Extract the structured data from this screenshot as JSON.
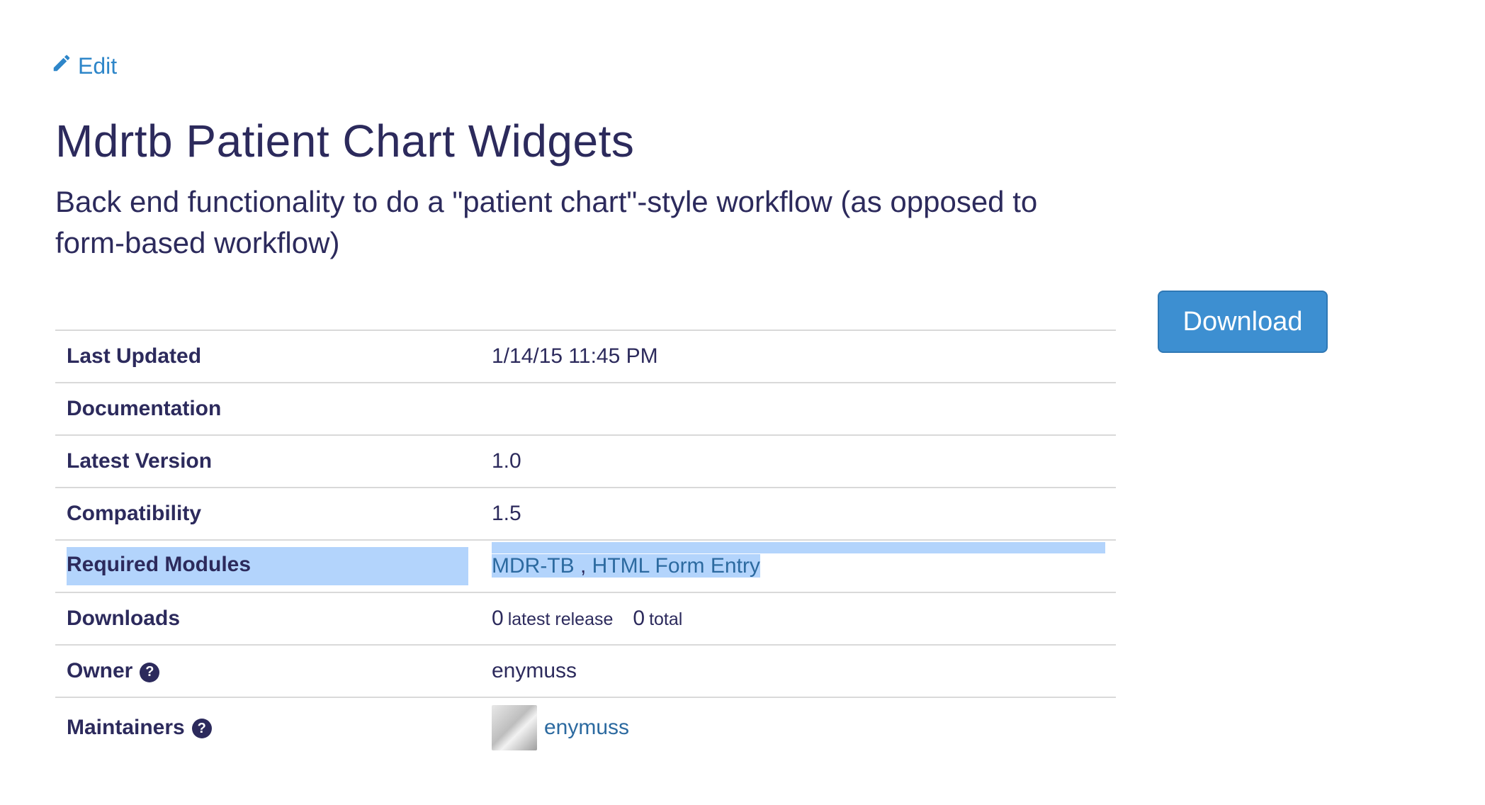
{
  "edit": {
    "label": "Edit"
  },
  "module": {
    "title": "Mdrtb Patient Chart Widgets",
    "description": "Back end functionality to do a \"patient chart\"-style workflow (as opposed to form-based workflow)"
  },
  "download": {
    "label": "Download"
  },
  "details": {
    "last_updated": {
      "label": "Last Updated",
      "value": "1/14/15 11:45 PM"
    },
    "documentation": {
      "label": "Documentation",
      "value": ""
    },
    "latest_version": {
      "label": "Latest Version",
      "value": "1.0"
    },
    "compatibility": {
      "label": "Compatibility",
      "value": "1.5"
    },
    "required_modules": {
      "label": "Required Modules",
      "modules": [
        "MDR-TB",
        "HTML Form Entry"
      ],
      "separator": " , "
    },
    "downloads": {
      "label": "Downloads",
      "latest_count": "0",
      "latest_label": "latest release",
      "total_count": "0",
      "total_label": "total"
    },
    "owner": {
      "label": "Owner",
      "value": "enymuss",
      "help": "?"
    },
    "maintainers": {
      "label": "Maintainers",
      "name": "enymuss",
      "help": "?"
    }
  },
  "colors": {
    "link": "#2e86c9",
    "text": "#2c2a5c",
    "button": "#3d8fd1",
    "selection": "#b3d4fc",
    "divider": "#d9d9d9"
  },
  "icons": {
    "edit": "pencil-icon",
    "help": "question-circle-icon"
  }
}
